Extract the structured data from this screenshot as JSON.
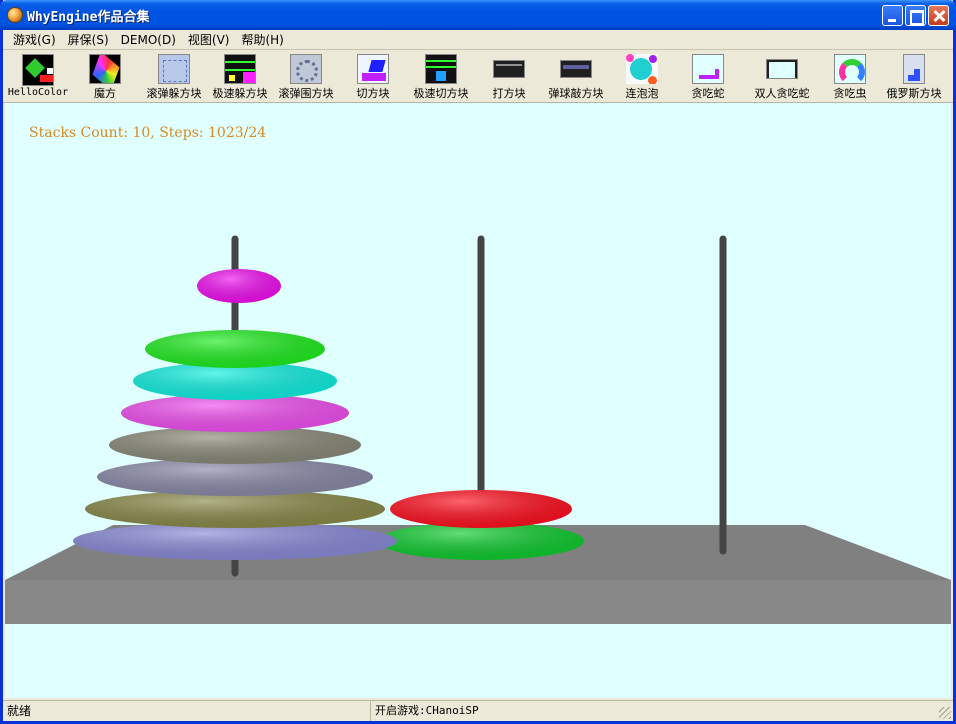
{
  "window": {
    "title": "WhyEngine作品合集"
  },
  "menu": [
    "游戏(G)",
    "屏保(S)",
    "DEMO(D)",
    "视图(V)",
    "帮助(H)"
  ],
  "toolbar": [
    {
      "label": "HelloColor",
      "icon": "hellocolor-icon"
    },
    {
      "label": "魔方",
      "icon": "rubik-cube-icon"
    },
    {
      "label": "滚弹躲方块",
      "icon": "ball-dodge-icon"
    },
    {
      "label": "极速躲方块",
      "icon": "speed-dodge-icon"
    },
    {
      "label": "滚弹围方块",
      "icon": "ball-surround-icon"
    },
    {
      "label": "切方块",
      "icon": "cut-block-icon"
    },
    {
      "label": "极速切方块",
      "icon": "speed-cut-icon"
    },
    {
      "label": "打方块",
      "icon": "hit-block-icon"
    },
    {
      "label": "弹球敲方块",
      "icon": "pinball-block-icon"
    },
    {
      "label": "连泡泡",
      "icon": "bubble-icon"
    },
    {
      "label": "贪吃蛇",
      "icon": "snake-icon"
    },
    {
      "label": "双人贪吃蛇",
      "icon": "two-player-snake-icon"
    },
    {
      "label": "贪吃虫",
      "icon": "worm-icon"
    },
    {
      "label": "俄罗斯方块",
      "icon": "tetris-icon"
    }
  ],
  "game": {
    "stats": "Stacks Count: 10, Steps: 1023/24",
    "stacks_count": 10,
    "steps_total": 1023,
    "steps_done": 24,
    "pegs": [
      {
        "disks": [
          {
            "color": "#8a8ad8"
          },
          {
            "color": "#8a8a4a"
          },
          {
            "color": "#8a8aa8"
          },
          {
            "color": "#8a8a7a"
          },
          {
            "color": "#f050f0"
          },
          {
            "color": "#10f0e0"
          },
          {
            "color": "#20ee20"
          }
        ]
      },
      {
        "disks": [
          {
            "color": "#10cc30"
          },
          {
            "color": "#ff1020"
          }
        ]
      },
      {
        "disks": []
      }
    ],
    "moving_disk": {
      "color": "#f010f0"
    }
  },
  "status": {
    "ready": "就绪",
    "game": "开启游戏:CHanoiSP"
  }
}
